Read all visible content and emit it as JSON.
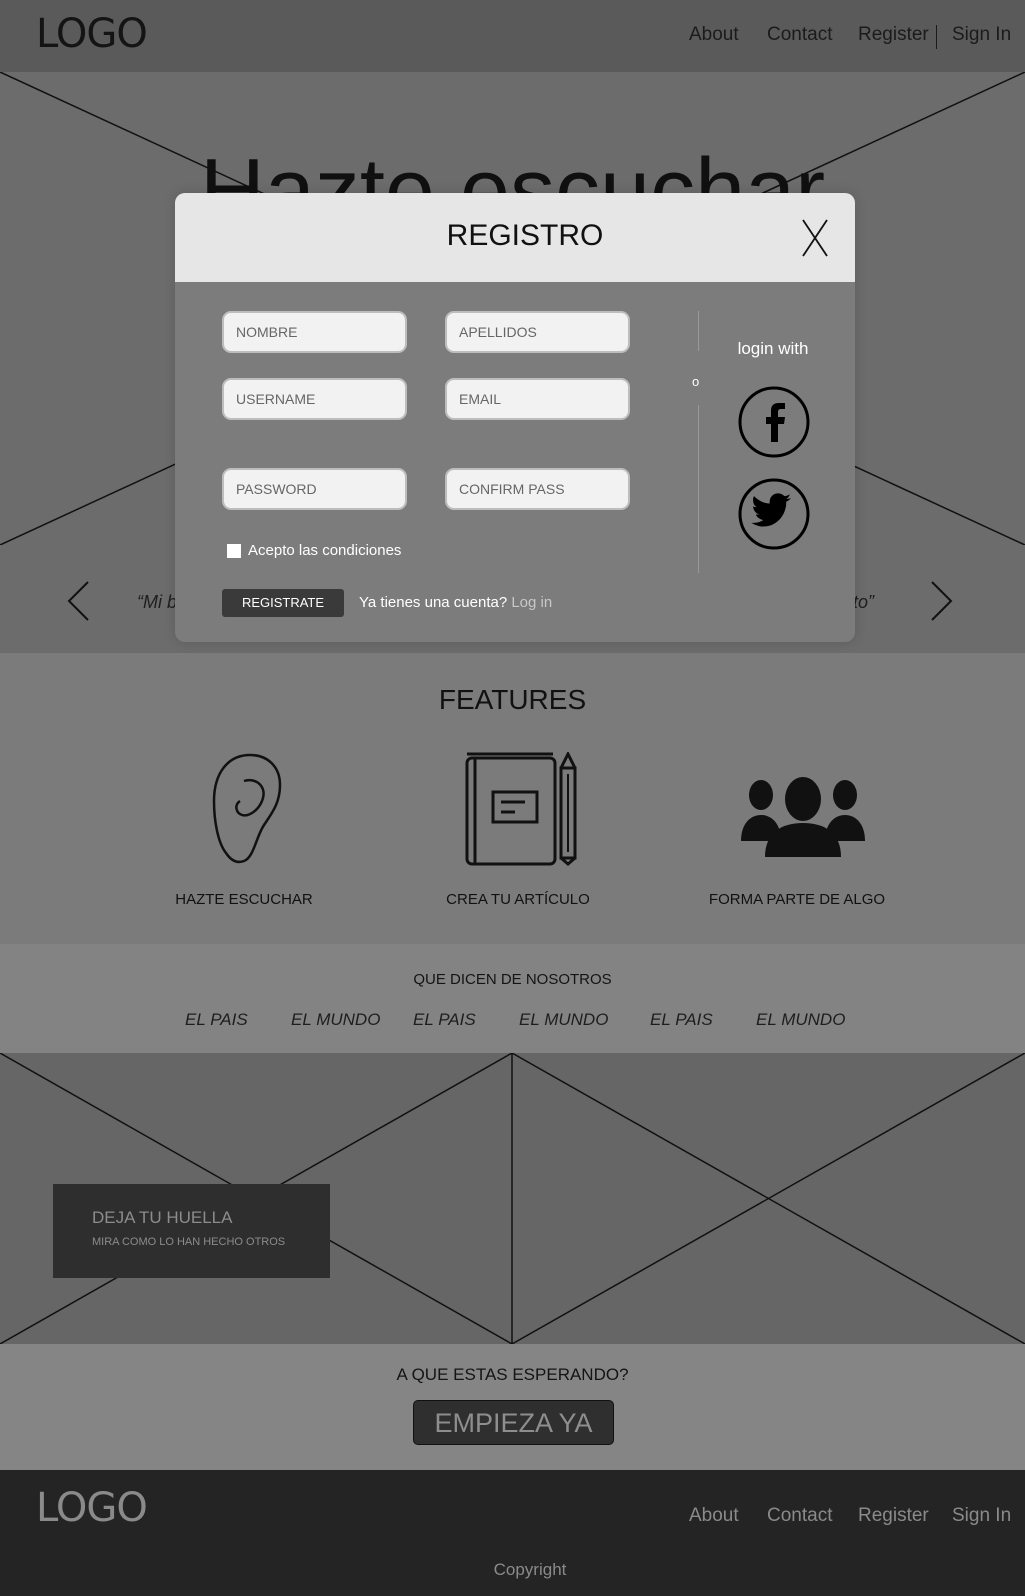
{
  "header": {
    "logo": "LOGO",
    "nav": [
      "About",
      "Contact",
      "Register",
      "Sign In"
    ]
  },
  "hero": {
    "title": "Hazte escuchar"
  },
  "quotes": {
    "left": "“Mi b",
    "right": "nto”"
  },
  "features": {
    "title": "FEATURES",
    "items": [
      {
        "label": "HAZTE ESCUCHAR",
        "icon": "ear-icon"
      },
      {
        "label": "CREA TU ARTÍCULO",
        "icon": "notebook-pencil-icon"
      },
      {
        "label": "FORMA PARTE DE ALGO",
        "icon": "group-icon"
      }
    ]
  },
  "press": {
    "title": "QUE DICEN DE NOSOTROS",
    "items": [
      "EL PAIS",
      "EL MUNDO",
      "EL PAIS",
      "EL MUNDO",
      "EL PAIS",
      "EL MUNDO"
    ]
  },
  "promo": {
    "title": "DEJA TU HUELLA",
    "subtitle": "MIRA COMO LO HAN HECHO OTROS"
  },
  "cta": {
    "title": "A QUE ESTAS ESPERANDO?",
    "button": "EMPIEZA YA"
  },
  "footer": {
    "logo": "LOGO",
    "nav": [
      "About",
      "Contact",
      "Register",
      "Sign In"
    ],
    "copyright": "Copyright"
  },
  "modal": {
    "title": "REGISTRO",
    "fields": {
      "nombre": "NOMBRE",
      "apellidos": "APELLIDOS",
      "username": "USERNAME",
      "email": "EMAIL",
      "password": "PASSWORD",
      "confirm": "CONFIRM PASS"
    },
    "terms": "Acepto las condiciones",
    "register_button": "REGISTRATE",
    "account_text": "Ya tienes una cuenta?",
    "login_link": "Log in",
    "divider": "o",
    "login_with": "login with",
    "social": [
      "facebook-icon",
      "twitter-icon"
    ]
  }
}
